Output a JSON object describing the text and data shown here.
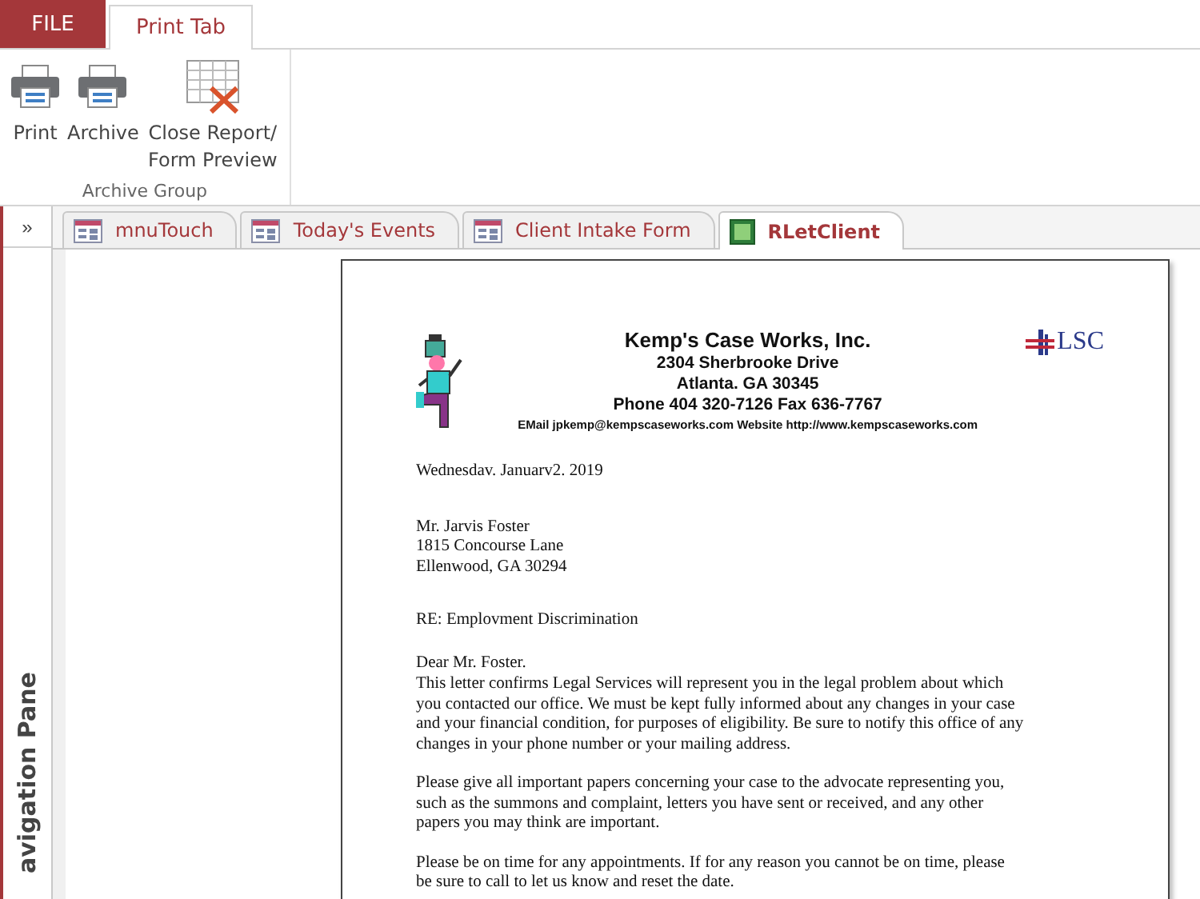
{
  "ribbon_tabs": [
    {
      "label": "FILE",
      "kind": "file",
      "selected": false
    },
    {
      "label": "Print Tab",
      "kind": "tab",
      "selected": true
    }
  ],
  "ribbon_group": {
    "label": "Archive Group",
    "buttons": [
      {
        "label": "Print",
        "kind": "printer"
      },
      {
        "label": "Archive",
        "kind": "printer"
      },
      {
        "label": "Close Report/ Form Preview",
        "kind": "close-preview"
      }
    ]
  },
  "navigation_pane": {
    "toggle": "»",
    "label": "avigation Pane"
  },
  "document_tabs": [
    {
      "label": "mnuTouch",
      "kind": "form",
      "selected": false
    },
    {
      "label": "Today's Events",
      "kind": "form",
      "selected": false
    },
    {
      "label": "Client Intake Form",
      "kind": "form",
      "selected": false
    },
    {
      "label": "RLetClient",
      "kind": "report",
      "selected": true
    }
  ],
  "letter": {
    "letterhead": {
      "company": "Kemp's Case Works, Inc.",
      "lines": [
        "2304 Sherbrooke Drive",
        "Atlanta. GA 30345",
        "Phone 404 320-7126  Fax 636-7767"
      ],
      "contact": "EMail jpkemp@kempscaseworks.com  Website http://www.kempscaseworks.com",
      "logo_text": "LSC"
    },
    "date": "Wednesdav. Januarv2. 2019",
    "address": [
      "Mr. Jarvis Foster",
      "1815 Concourse Lane",
      "Ellenwood, GA  30294"
    ],
    "subject": "RE: Emplovment Discrimination",
    "salutation": "Dear Mr. Foster.",
    "paragraphs": [
      "This letter confirms Legal Services will represent you in the legal problem about which you contacted our office.  We must be kept fully informed about any changes in your case and your financial condition, for purposes of eligibility. Be sure to notify this office of any changes in your phone number or your mailing address.",
      "Please give all important papers concerning your case to the advocate representing you, such as the summons and complaint, letters you have sent or received, and any other papers you may think are important.",
      "Please be on time for any appointments.  If for any reason you cannot be on time, please be sure to call to let us know and reset the date."
    ]
  }
}
